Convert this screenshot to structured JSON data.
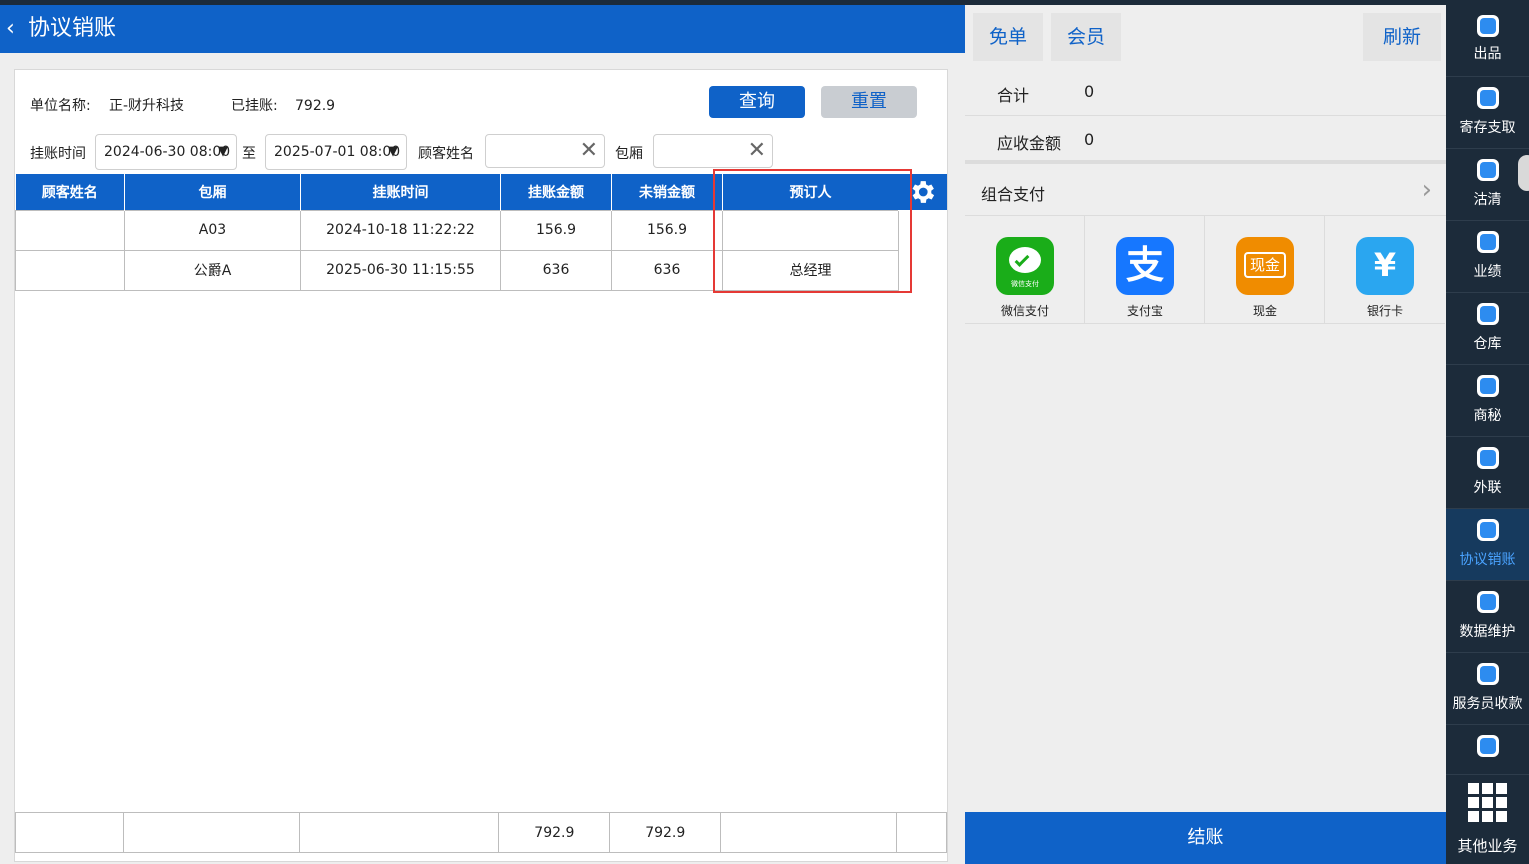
{
  "header": {
    "back_icon": "‹",
    "title": "协议销账"
  },
  "filters": {
    "unit_label": "单位名称:",
    "unit_value": "正-财升科技",
    "posted_label": "已挂账:",
    "posted_value": "792.9",
    "query_button": "查询",
    "reset_button": "重置",
    "time_label": "挂账时间",
    "date_from": "2024-06-30 08:00",
    "to_label": "至",
    "date_to": "2025-07-01 08:00",
    "customer_label": "顾客姓名",
    "customer_value": "",
    "room_label": "包厢",
    "room_value": ""
  },
  "table": {
    "columns": [
      "顾客姓名",
      "包厢",
      "挂账时间",
      "挂账金额",
      "未销金额",
      "预订人"
    ],
    "rows": [
      [
        "",
        "A03",
        "2024-10-18 11:22:22",
        "156.9",
        "156.9",
        ""
      ],
      [
        "",
        "公爵A",
        "2025-06-30 11:15:55",
        "636",
        "636",
        "总经理"
      ]
    ],
    "footer": [
      "",
      "",
      "",
      "792.9",
      "792.9",
      ""
    ]
  },
  "right_panel": {
    "free_button": "免单",
    "member_button": "会员",
    "refresh_button": "刷新",
    "total_label": "合计",
    "total_value": "0",
    "receivable_label": "应收金额",
    "receivable_value": "0",
    "combo_pay_label": "组合支付",
    "payments": [
      {
        "label": "微信支付",
        "icon": "wechat-pay-icon",
        "color": "#1aad19",
        "badge": "微信支付"
      },
      {
        "label": "支付宝",
        "icon": "alipay-icon",
        "color": "#1677ff",
        "badge": "支"
      },
      {
        "label": "现金",
        "icon": "cash-icon",
        "color": "#f08c00",
        "badge": "现金"
      },
      {
        "label": "银行卡",
        "icon": "bank-card-icon",
        "color": "#2aa6f0",
        "badge": "¥"
      }
    ],
    "checkout_button": "结账"
  },
  "sidebar": {
    "items": [
      {
        "label": "出品",
        "icon": "upload-icon"
      },
      {
        "label": "寄存支取",
        "icon": "download-icon"
      },
      {
        "label": "沽清",
        "icon": "list-icon"
      },
      {
        "label": "业绩",
        "icon": "pie-chart-icon"
      },
      {
        "label": "仓库",
        "icon": "grid-icon"
      },
      {
        "label": "商秘",
        "icon": "download-icon"
      },
      {
        "label": "外联",
        "icon": "person-icon"
      },
      {
        "label": "协议销账",
        "icon": "download-icon",
        "active": true
      },
      {
        "label": "数据维护",
        "icon": "pie-chart-icon"
      },
      {
        "label": "服务员收款",
        "icon": "person-icon"
      },
      {
        "label": "",
        "icon": "store-icon"
      },
      {
        "label": "其他业务",
        "icon": "apps-grid-icon"
      }
    ]
  },
  "colors": {
    "primary": "#0f62c8",
    "sidebar_bg": "#1c2b3a",
    "highlight": "#e53935"
  }
}
